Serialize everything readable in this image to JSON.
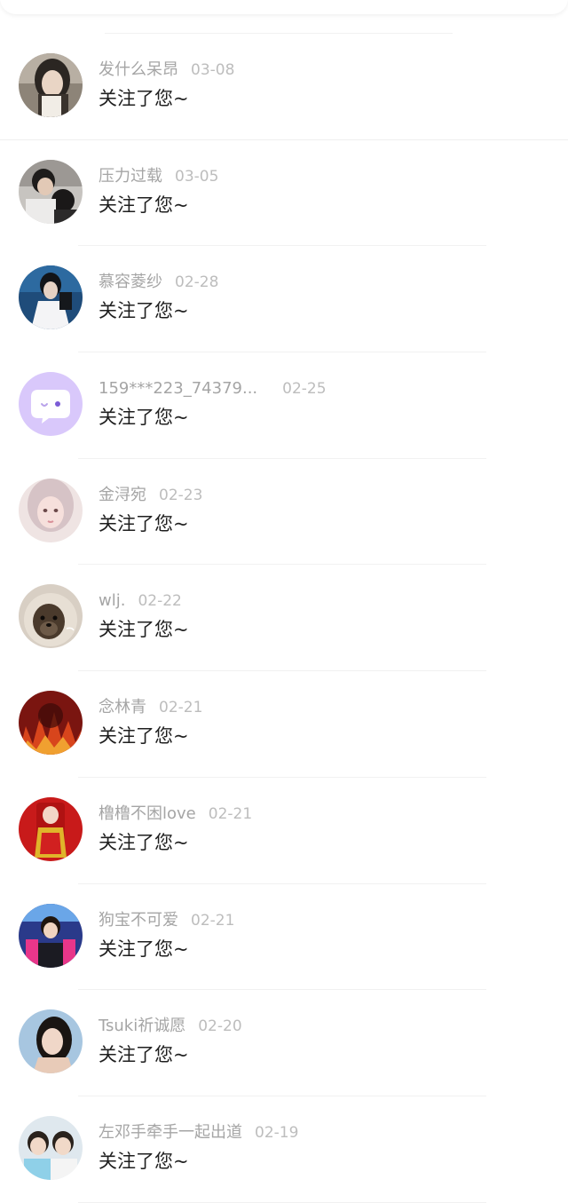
{
  "notifications": [
    {
      "name": "发什么呆昂",
      "date": "03-08",
      "message": "关注了您~",
      "avatar": "girl-portrait-avatar"
    },
    {
      "name": "压力过载",
      "date": "03-05",
      "message": "关注了您~",
      "avatar": "couple-photo-avatar"
    },
    {
      "name": "慕容菱纱",
      "date": "02-28",
      "message": "关注了您~",
      "avatar": "costume-actor-avatar"
    },
    {
      "name": "159***223_74379...",
      "date": "02-25",
      "message": "关注了您~",
      "avatar": "default-chat-bubble-avatar"
    },
    {
      "name": "金浔宛",
      "date": "02-23",
      "message": "关注了您~",
      "avatar": "pink-hair-girl-avatar"
    },
    {
      "name": "wlj.",
      "date": "02-22",
      "message": "关注了您~",
      "avatar": "otter-avatar"
    },
    {
      "name": "念林青",
      "date": "02-21",
      "message": "关注了您~",
      "avatar": "red-fire-art-avatar"
    },
    {
      "name": "橹橹不困love",
      "date": "02-21",
      "message": "关注了您~",
      "avatar": "red-festival-avatar"
    },
    {
      "name": "狗宝不可爱",
      "date": "02-21",
      "message": "关注了您~",
      "avatar": "singer-stage-avatar"
    },
    {
      "name": "Tsuki祈诚愿",
      "date": "02-20",
      "message": "关注了您~",
      "avatar": "woman-portrait-avatar"
    },
    {
      "name": "左邓手牵手一起出道",
      "date": "02-19",
      "message": "关注了您~",
      "avatar": "two-boys-avatar"
    }
  ],
  "colors": {
    "name_text": "#a5a5a5",
    "date_text": "#bdbdbd",
    "message_text": "#1f1f1f",
    "divider": "#f1f1f1",
    "default_avatar_bg": "#d9c8fb"
  }
}
